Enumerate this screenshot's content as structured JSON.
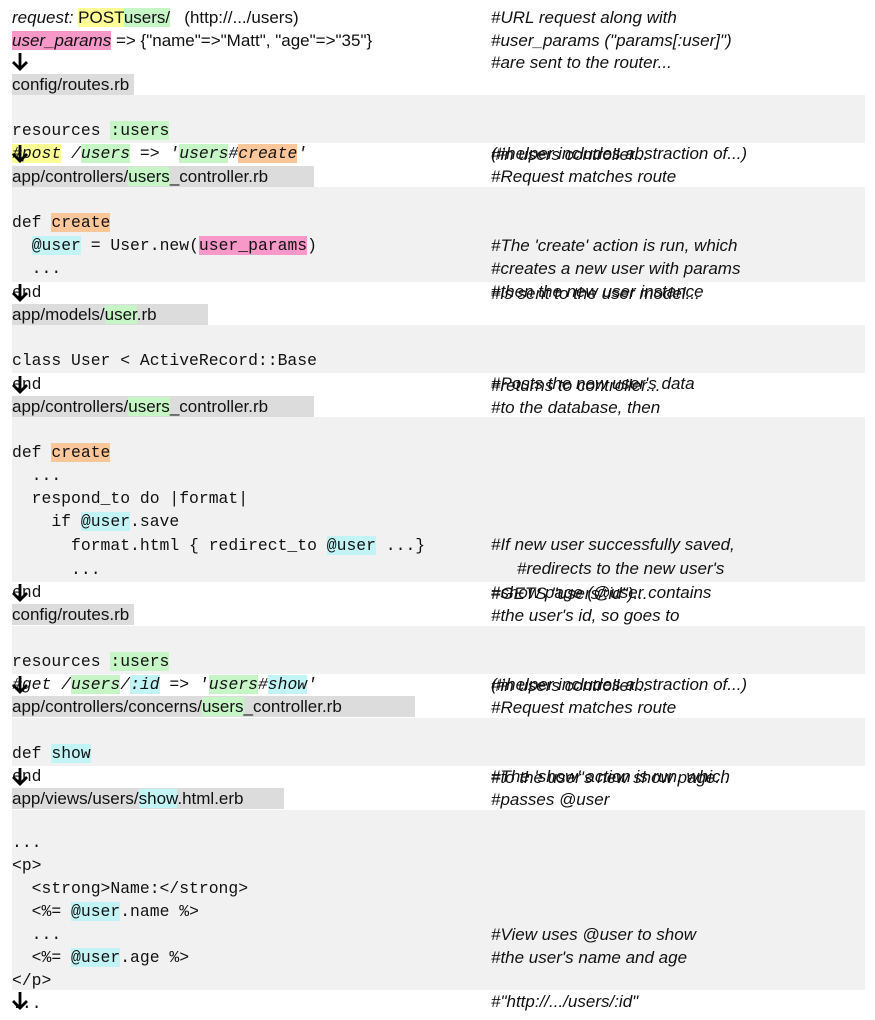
{
  "notes": {
    "n1": "#URL request along with",
    "n2": "#user_params (\"params[:user]\")",
    "n3": "#are sent to the router...",
    "n4": "(#helper includes abstraction of...)",
    "n5": "#Request matches route",
    "n6": "#in users controller...",
    "n7": "#The 'create' action is run, which",
    "n8": "#creates a new user with params",
    "n9": "#then the new user instance",
    "n10": "#is sent to the user model...",
    "n11": "#Posts the new user's data",
    "n12": "#to the database, then",
    "n13": "#returns to controller...",
    "n14": "#If new user successfully saved,",
    "n15": "#redirects to the new user's",
    "n16": "#show page (@user contains",
    "n17": "#the user's id, so goes to",
    "n18": "#GETS \"users/:id\")...",
    "n19": "(#helper includes abstraction of...)",
    "n20": "#Request matches route",
    "n21": "#in users controller...",
    "n22": "#The 'show' action is run, which",
    "n23": "#passes @user",
    "n24": "#to the user's new show page...",
    "n25": "#View uses @user to show",
    "n26": "#the user's name and age",
    "n27": "#\"http://.../users/:id\""
  },
  "request": {
    "label": "request:",
    "verb": "POST",
    "path": "users/",
    "url": "   (http://.../users)",
    "params_name": "user_params",
    "params_value": " => {\"name\"=>\"Matt\", \"age\"=>\"35\"}"
  },
  "files": {
    "routes1_a": "config/",
    "routes1_b": "routes.rb",
    "ctrl1_a": "app/controllers/",
    "ctrl1_b": "users",
    "ctrl1_c": "_controller.rb",
    "model_a": "app/models/",
    "model_b": "user",
    "model_c": ".rb",
    "ctrl2_a": "app/controllers/",
    "ctrl2_b": "users",
    "ctrl2_c": "_controller.rb",
    "routes2_a": "config/",
    "routes2_b": "routes.rb",
    "ctrl3_a": "app/controllers/concerns/",
    "ctrl3_b": "users",
    "ctrl3_c": "_controller.rb",
    "view_a": "app/views/users/",
    "view_b": "show",
    "view_c": ".html.erb"
  },
  "code": {
    "r1_kw": "resources ",
    "r1_sym": ":users",
    "r2_a": "#post",
    "r2_b": " /",
    "r2_c": "users",
    "r2_d": " => '",
    "r2_e": "users",
    "r2_f": "#",
    "r2_g": "create",
    "r2_h": "'",
    "c1_def": "def ",
    "c1_name": "create",
    "c2_a": "  ",
    "c2_ivar": "@user",
    "c2_b": " = User.new(",
    "c2_param": "user_params",
    "c2_c": ")",
    "c3": "  ...",
    "c4": "end",
    "m1": "class User < ActiveRecord::Base",
    "m2": "end",
    "d1_def": "def ",
    "d1_name": "create",
    "d2": "  ...",
    "d3": "  respond_to do |format|",
    "d4_a": "    if ",
    "d4_ivar": "@user",
    "d4_b": ".save",
    "d5_a": "      format.html { redirect_to ",
    "d5_ivar": "@user",
    "d5_b": " ...}",
    "d6": "      ...",
    "d7": "end",
    "s1_kw": "resources ",
    "s1_sym": ":users",
    "s2_a": "#get /",
    "s2_b": "users",
    "s2_c": "/",
    "s2_d": ":id",
    "s2_e": " => '",
    "s2_f": "users",
    "s2_g": "#",
    "s2_h": "show",
    "s2_i": "'",
    "t1_def": "def ",
    "t1_name": "show",
    "t2": "end",
    "v1": "...",
    "v2": "<p>",
    "v3": "  <strong>Name:</strong>",
    "v4_a": "  <%= ",
    "v4_ivar": "@user",
    "v4_b": ".name %>",
    "v5": "  ...",
    "v6_a": "  <%= ",
    "v6_ivar": "@user",
    "v6_b": ".age %>",
    "v7": "</p>",
    "v8": "..."
  }
}
